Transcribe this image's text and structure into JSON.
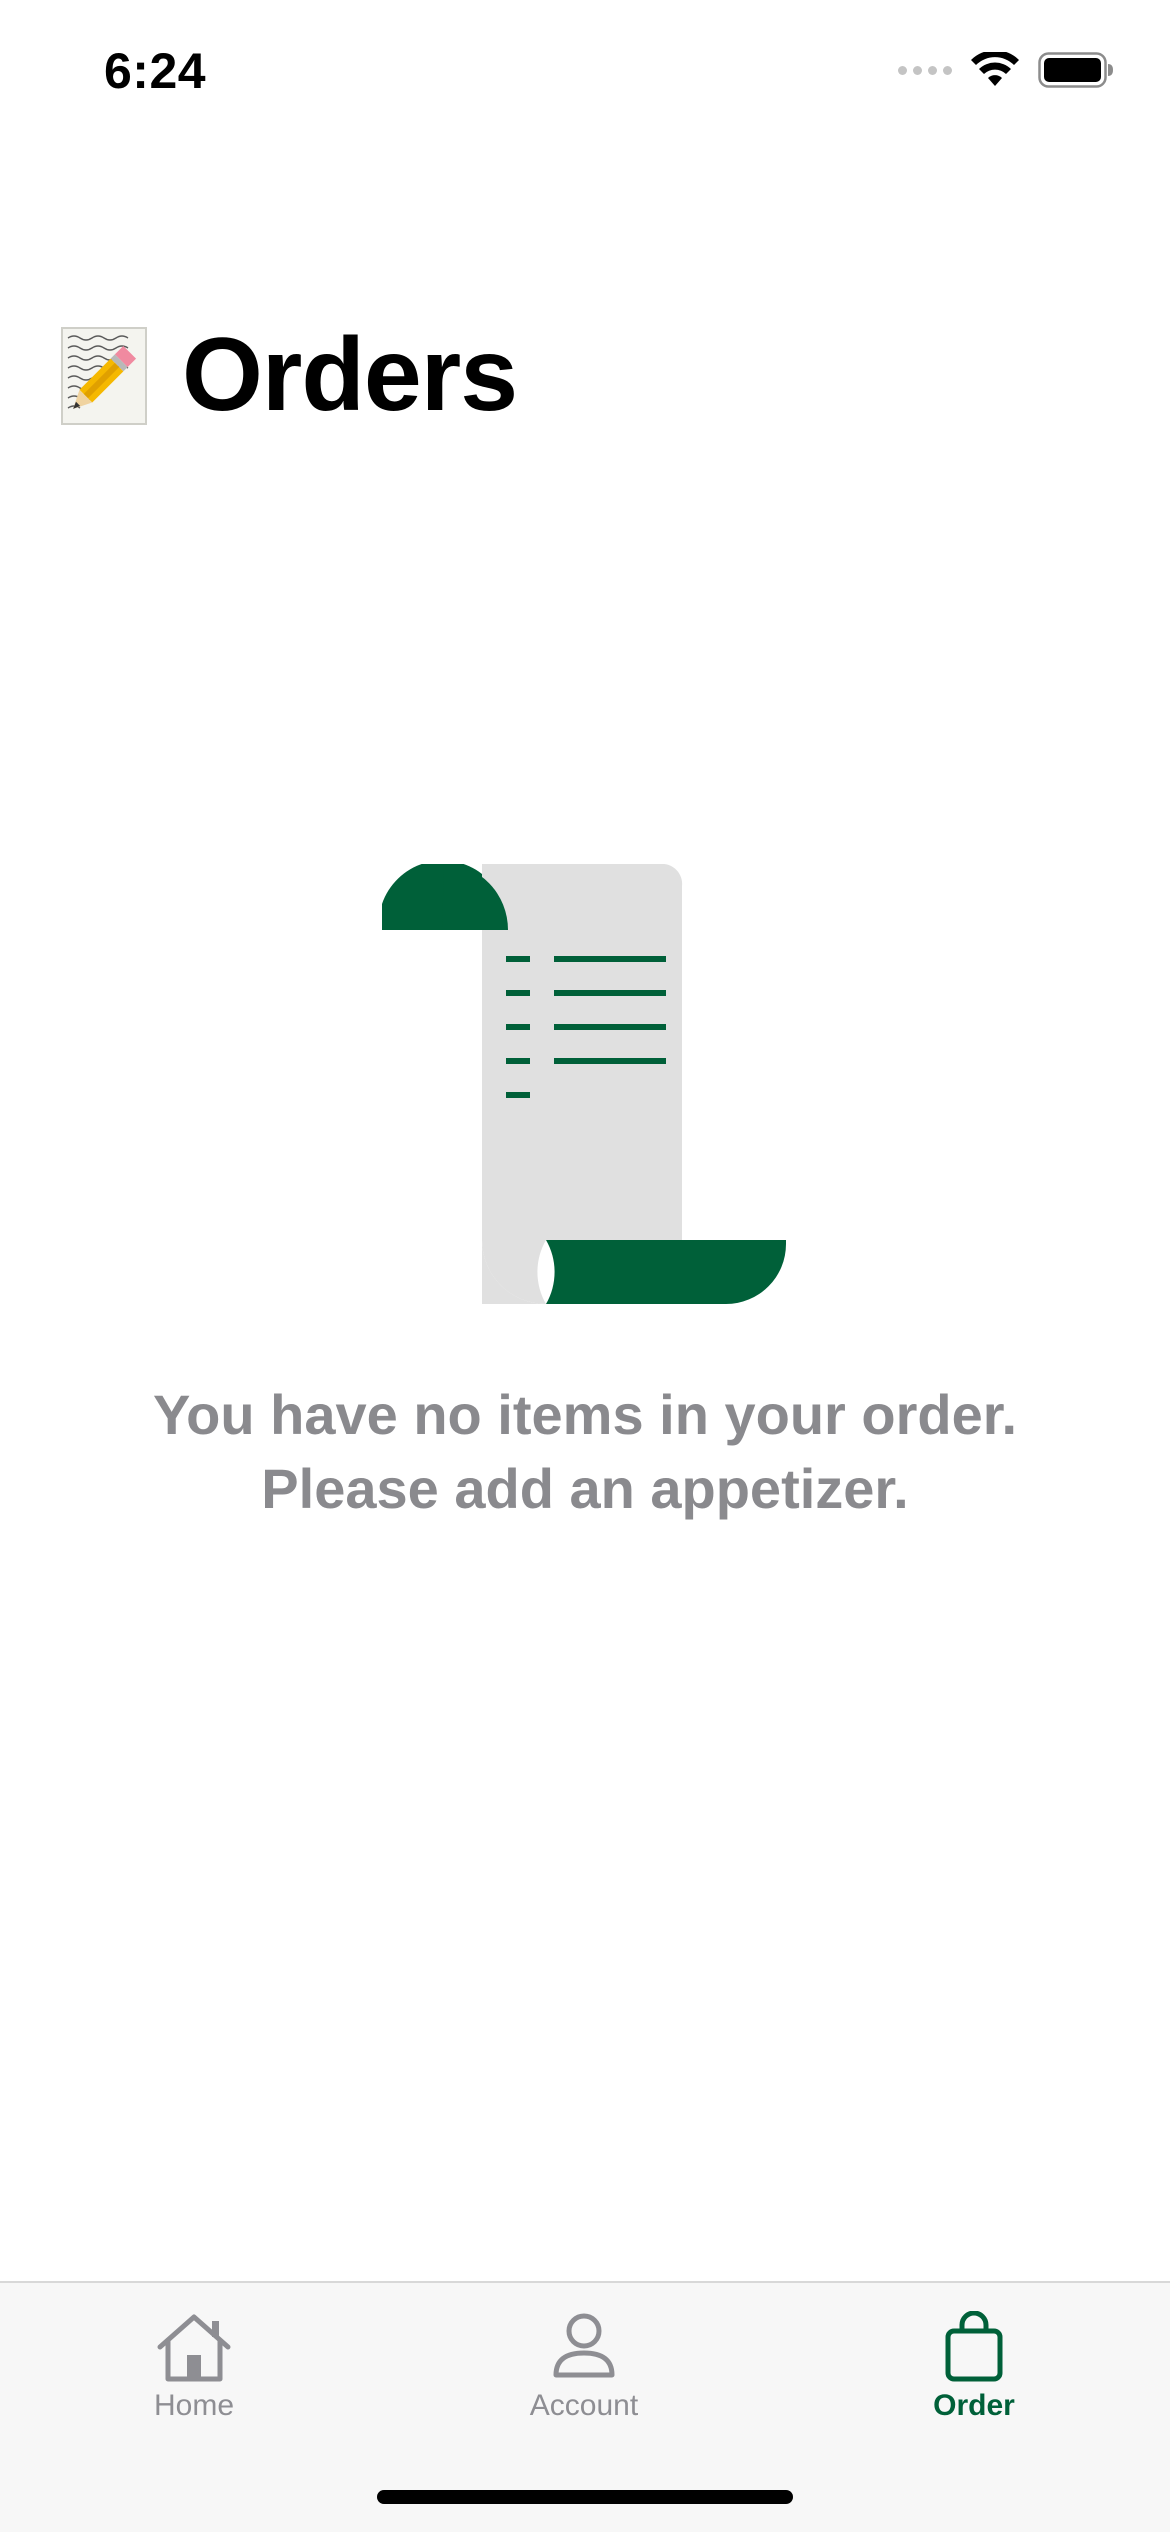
{
  "status_bar": {
    "time": "6:24",
    "icons": [
      "cellular-signal-icon",
      "wifi-icon",
      "battery-icon"
    ]
  },
  "header": {
    "icon": "memo-pencil-icon",
    "title": "Orders"
  },
  "empty_state": {
    "illustration": "receipt-scroll-icon",
    "message_line1": "You have no items in your order.",
    "message_line2": "Please add an appetizer."
  },
  "tab_bar": {
    "tabs": [
      {
        "label": "Home",
        "icon": "house-icon",
        "active": false
      },
      {
        "label": "Account",
        "icon": "person-icon",
        "active": false
      },
      {
        "label": "Order",
        "icon": "shopping-bag-icon",
        "active": true
      }
    ]
  },
  "colors": {
    "accent": "#006039",
    "muted_text": "#8a8a8e",
    "paper": "#e0e0e0",
    "tab_bar_bg": "#f7f7f7"
  }
}
